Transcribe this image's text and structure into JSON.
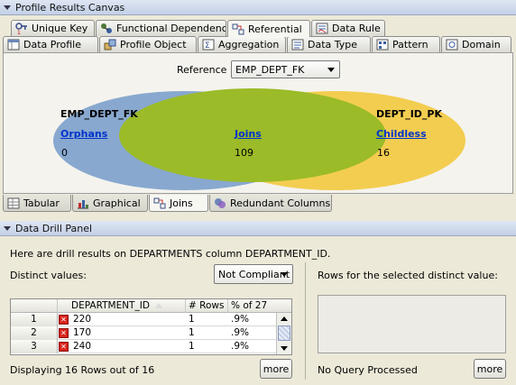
{
  "profile_panel": {
    "title": "Profile Results Canvas",
    "tabs_row1": [
      {
        "label": "Unique Key",
        "icon": "unique-key-icon"
      },
      {
        "label": "Functional Dependency",
        "icon": "functional-dependency-icon"
      },
      {
        "label": "Referential",
        "icon": "referential-icon"
      },
      {
        "label": "Data Rule",
        "icon": "data-rule-icon"
      }
    ],
    "tabs_row2": [
      {
        "label": "Data Profile",
        "icon": "data-profile-icon"
      },
      {
        "label": "Profile Object",
        "icon": "profile-object-icon"
      },
      {
        "label": "Aggregation",
        "icon": "aggregation-icon"
      },
      {
        "label": "Data Type",
        "icon": "data-type-icon"
      },
      {
        "label": "Pattern",
        "icon": "pattern-icon"
      },
      {
        "label": "Domain",
        "icon": "domain-icon"
      }
    ],
    "active_tab": "Referential",
    "reference_label": "Reference :",
    "reference_value": "EMP_DEPT_FK",
    "venn": {
      "left_title": "EMP_DEPT_FK",
      "left_link": "Orphans",
      "left_count": "0",
      "center_link": "Joins",
      "center_count": "109",
      "right_title": "DEPT_ID_PK",
      "right_link": "Childless",
      "right_count": "16",
      "colors": {
        "left": "#88a8cf",
        "center": "#9bbb28",
        "right": "#f3cd50"
      }
    },
    "bottom_tabs": [
      {
        "label": "Tabular",
        "icon": "table-icon"
      },
      {
        "label": "Graphical",
        "icon": "bar-chart-icon"
      },
      {
        "label": "Joins",
        "icon": "joins-icon"
      },
      {
        "label": "Redundant Columns",
        "icon": "redundant-columns-icon"
      }
    ],
    "active_bottom_tab": "Joins"
  },
  "drill_panel": {
    "title": "Data Drill Panel",
    "intro": "Here are drill results on DEPARTMENTS column DEPARTMENT_ID.",
    "distinct_label": "Distinct values:",
    "filter_value": "Not Compliant",
    "rows_label": "Rows for the selected distinct value:",
    "table": {
      "headers": [
        "DEPARTMENT_ID",
        "# Rows",
        "% of 27"
      ],
      "rows": [
        {
          "n": "1",
          "dept": "220",
          "rows": "1",
          "pct": ".9%"
        },
        {
          "n": "2",
          "dept": "170",
          "rows": "1",
          "pct": ".9%"
        },
        {
          "n": "3",
          "dept": "240",
          "rows": "1",
          "pct": ".9%"
        }
      ]
    },
    "displaying": "Displaying 16 Rows out of 16",
    "more_label": "more",
    "query_status": "No Query Processed",
    "more_label_right": "more"
  }
}
